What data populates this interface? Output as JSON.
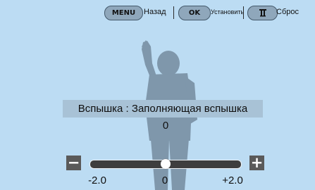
{
  "hints": {
    "menu_key": "MENU",
    "menu_action": "Назад",
    "ok_key": "OK",
    "ok_action": "Установить",
    "reset_action": "Сброс"
  },
  "setting": {
    "label": "Вспышка : Заполняющая вспышка",
    "value": "0"
  },
  "slider": {
    "min_label": "-2.0",
    "mid_label": "0",
    "max_label": "+2.0",
    "level": 0.5
  }
}
